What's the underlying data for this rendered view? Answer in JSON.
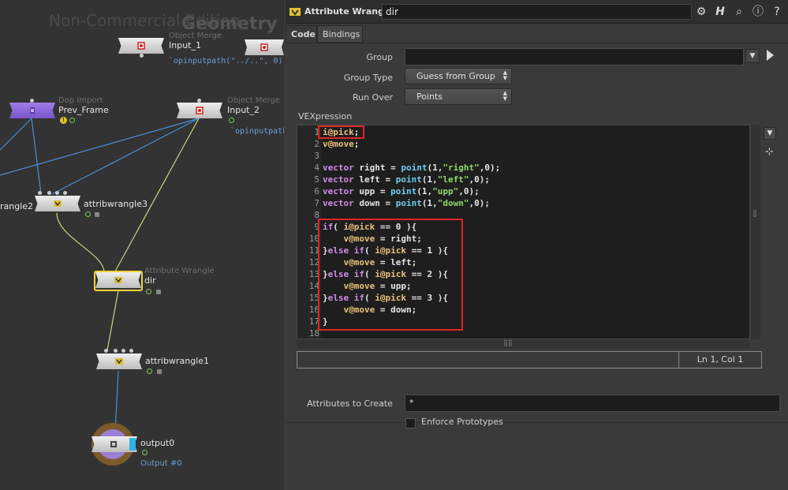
{
  "network": {
    "watermark": "Non-Commercial Edition",
    "context_title": "Geometry",
    "nodes": {
      "input1": {
        "type": "Object Merge",
        "name": "Input_1",
        "expr": "`opinputpath(\"../..\", 0)`"
      },
      "input2": {
        "type": "Object Merge",
        "name": "Input_2",
        "expr": "`opinputpath(\""
      },
      "prevframe": {
        "type": "Dop Import",
        "name": "Prev_Frame"
      },
      "wrangle2": {
        "name": "rangle2"
      },
      "wrangle3": {
        "name": "attribwrangle3"
      },
      "dir": {
        "type": "Attribute Wrangle",
        "name": "dir"
      },
      "wrangle1": {
        "name": "attribwrangle1"
      },
      "output0": {
        "name": "output0",
        "sub": "Output #0"
      }
    }
  },
  "params": {
    "header": {
      "type_label": "Attribute Wrangle",
      "node_name": "dir"
    },
    "header_buttons": [
      "gear-icon",
      "houdini-help-icon",
      "search-icon",
      "info-icon",
      "help-icon"
    ],
    "tabs": [
      {
        "label": "Code"
      },
      {
        "label": "Bindings"
      }
    ],
    "group": {
      "label": "Group",
      "value": ""
    },
    "group_type": {
      "label": "Group Type",
      "value": "Guess from Group"
    },
    "run_over": {
      "label": "Run Over",
      "value": "Points"
    },
    "vexpression": {
      "label": "VEXpression"
    },
    "status_position": "Ln 1, Col 1",
    "attributes_to_create": {
      "label": "Attributes to Create",
      "value": "*"
    },
    "enforce_prototypes": {
      "label": "Enforce Prototypes",
      "checked": false
    },
    "code_lines": [
      "i@pick;",
      "v@move;",
      "",
      "vector right = point(1,\"right\",0);",
      "vector left = point(1,\"left\",0);",
      "vector upp = point(1,\"upp\",0);",
      "vector down = point(1,\"down\",0);",
      "",
      "if( i@pick == 0 ){",
      "    v@move = right;",
      "}else if( i@pick == 1 ){",
      "    v@move = left;",
      "}else if( i@pick == 2 ){",
      "    v@move = upp;",
      "}else if( i@pick == 3 ){",
      "    v@move = down;",
      "}",
      ""
    ],
    "colors": {
      "keyword": "#d08be8",
      "attribute": "#e8c27a",
      "function": "#6fcff0",
      "string": "#93d66a",
      "highlight_box": "#e0242c",
      "selected_node": "#f1d33b"
    }
  }
}
